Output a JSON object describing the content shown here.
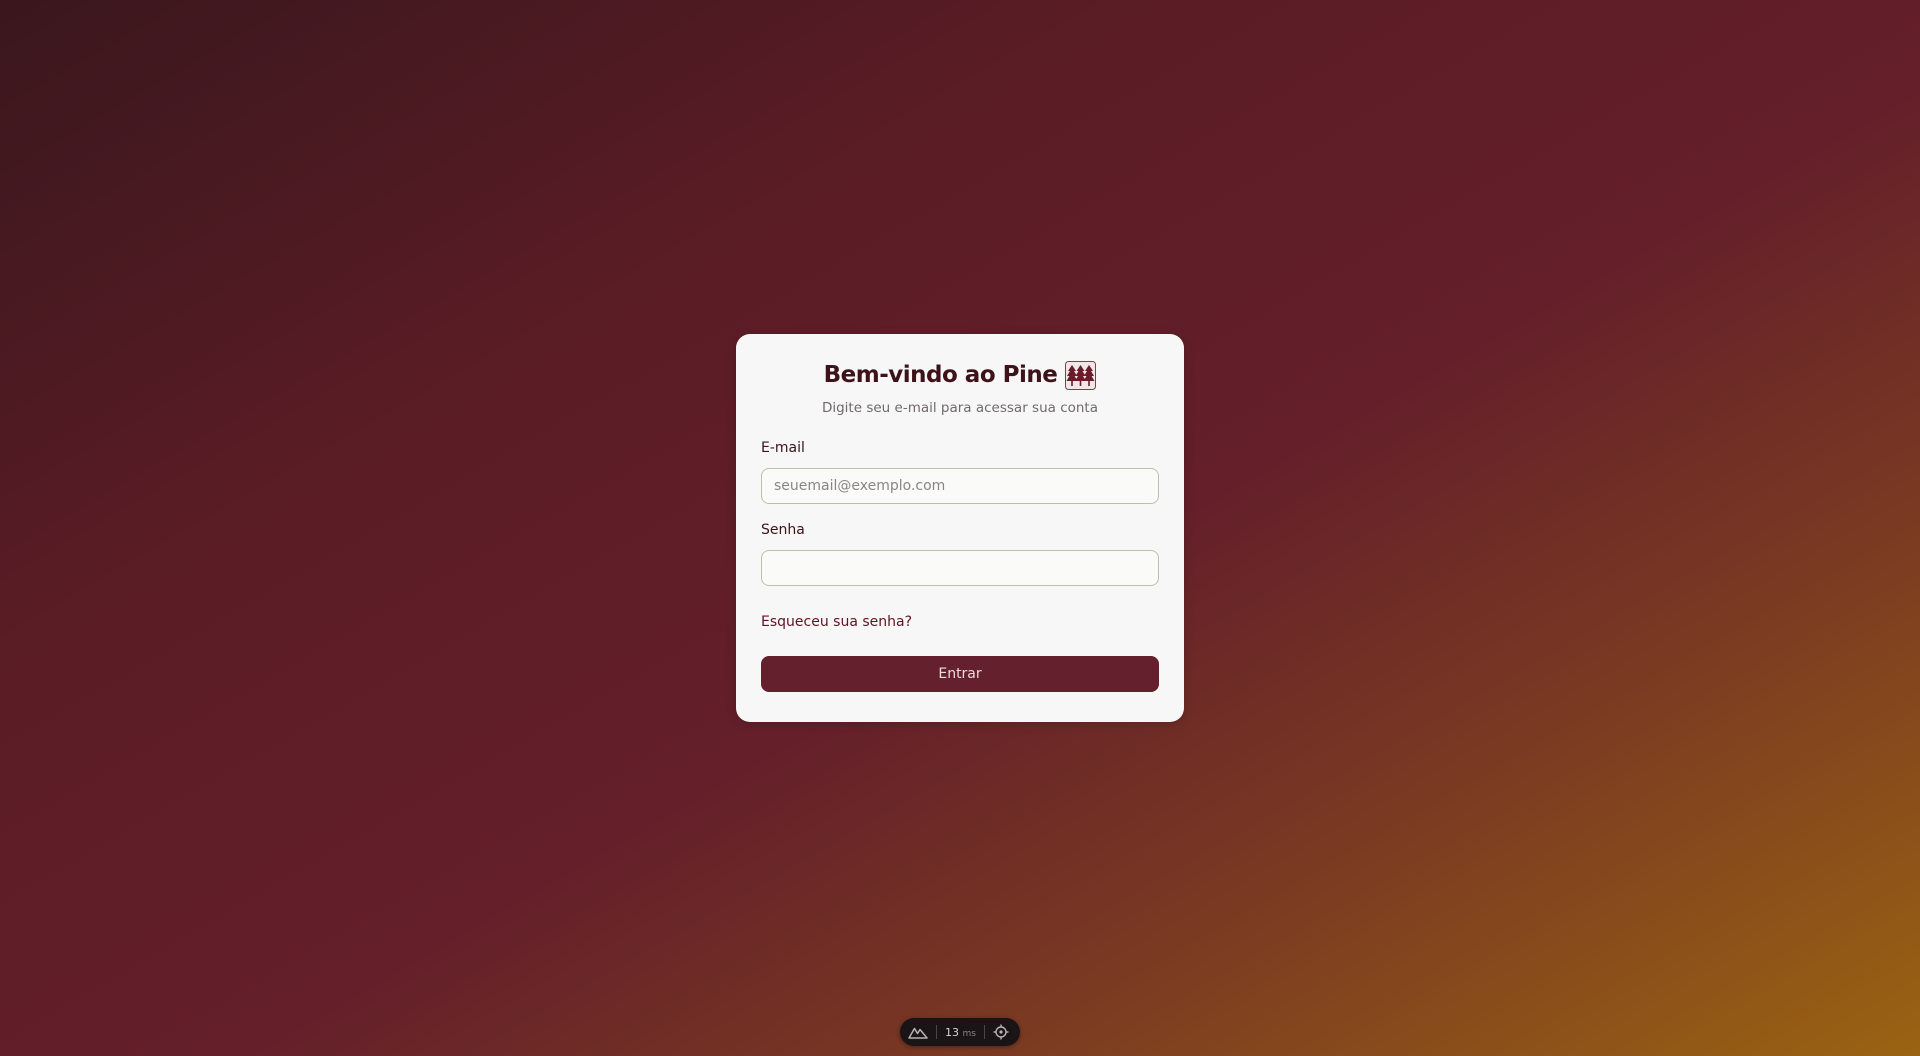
{
  "login": {
    "title": "Bem-vindo ao Pine",
    "title_icon": "pine-trees-icon",
    "subtitle": "Digite seu e-mail para acessar sua conta",
    "email_label": "E-mail",
    "email_placeholder": "seuemail@exemplo.com",
    "email_value": "",
    "password_label": "Senha",
    "password_value": "",
    "forgot_label": "Esqueceu sua senha?",
    "submit_label": "Entrar"
  },
  "devtools": {
    "logo_icon": "nuxt-logo-icon",
    "timing_value": "13",
    "timing_unit": "ms",
    "inspect_icon": "crosshair-icon"
  },
  "colors": {
    "accent": "#65202d",
    "title": "#3d1219",
    "card": "#f8f7f7",
    "input_border": "#b9c2a6"
  }
}
